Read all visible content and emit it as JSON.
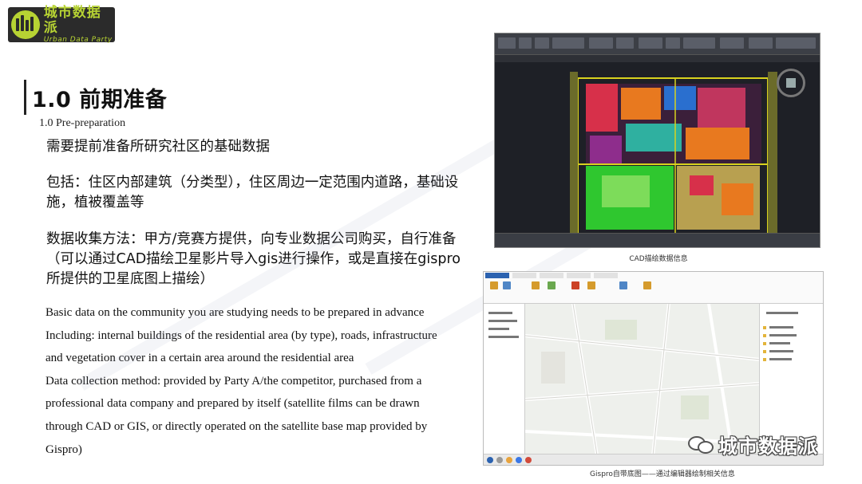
{
  "logo": {
    "name_cn": "城市数据派",
    "name_en": "Urban Data Party",
    "brand_color": "#b7d333",
    "icon": "logo-icon"
  },
  "heading": {
    "title": "1.0  前期准备",
    "subtitle": "1.0 Pre-preparation"
  },
  "body_cn": {
    "line1": "需要提前准备所研究社区的基础数据",
    "para2": "包括：住区内部建筑（分类型），住区周边一定范围内道路，基础设施，植被覆盖等",
    "para3": "数据收集方法：甲方/竞赛方提供，向专业数据公司购买，自行准备（可以通过CAD描绘卫星影片导入gis进行操作，或是直接在gispro所提供的卫星底图上描绘）"
  },
  "body_en": [
    "Basic data on the community you are studying needs to be prepared in advance",
    "Including: internal buildings of the residential area (by type), roads, infrastructure",
    "and vegetation cover in a certain area around the residential area",
    "Data collection method: provided by Party A/the competitor, purchased from a",
    "professional data company and prepared by itself (satellite films can be drawn",
    "through CAD or GIS, or directly operated on the satellite base map provided by",
    "Gispro)"
  ],
  "figures": {
    "cad_caption": "CAD描绘数据信息",
    "gis_caption": "Gispro自带底图——通过编辑器绘制相关信息"
  },
  "badge": {
    "text": "城市数据派",
    "icon": "wechat-icon"
  },
  "colors": {
    "cad_background": "#23252b",
    "cad_buildings_red": "#d7304a",
    "cad_buildings_orange": "#e8791f",
    "cad_green": "#2fc72f",
    "cad_yellow_lines": "#d8d21e"
  }
}
